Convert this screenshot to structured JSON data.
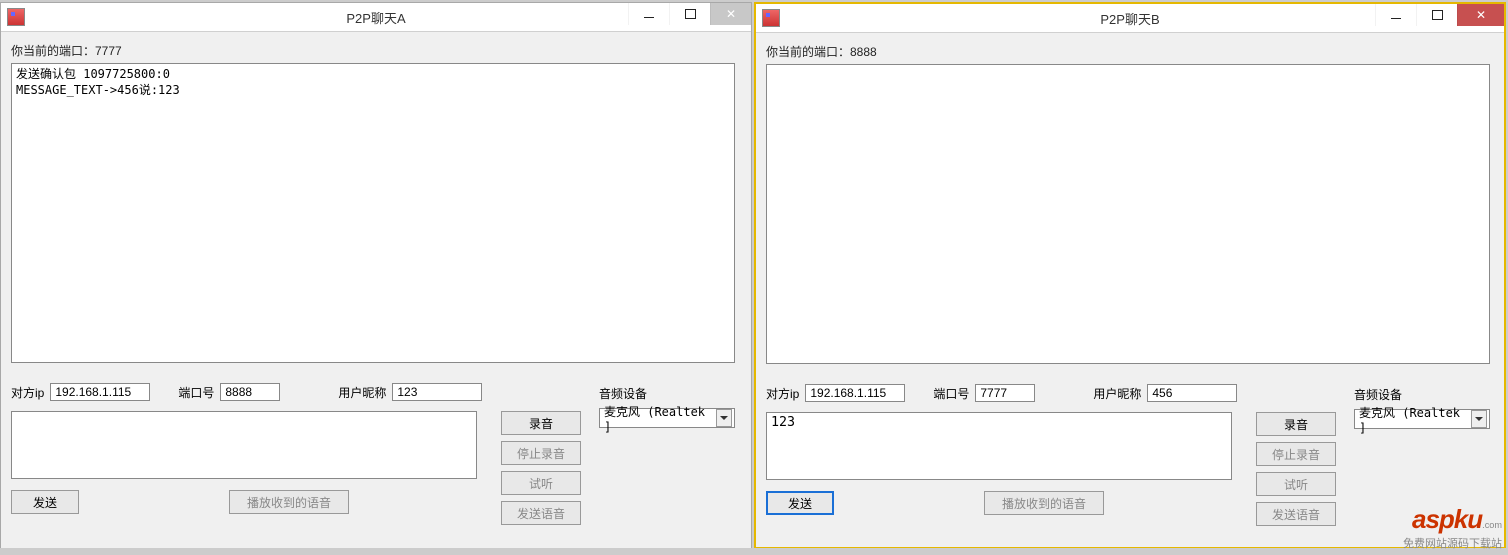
{
  "windowA": {
    "title": "P2P聊天A",
    "port_label": "你当前的端口：7777",
    "chat_log": "发送确认包 1097725800:0\nMESSAGE_TEXT->456说:123",
    "peer_ip_label": "对方ip",
    "peer_ip": "192.168.1.115",
    "port_num_label": "端口号",
    "port_num": "8888",
    "nickname_label": "用户昵称",
    "nickname": "123",
    "message_input": "",
    "send_btn": "发送",
    "play_btn": "播放收到的语音",
    "record_btn": "录音",
    "stop_record_btn": "停止录音",
    "preview_btn": "试听",
    "send_voice_btn": "发送语音",
    "audio_device_label": "音频设备",
    "audio_device": "麦克风 (Realtek ]"
  },
  "windowB": {
    "title": "P2P聊天B",
    "port_label": "你当前的端口：8888",
    "chat_log": "",
    "peer_ip_label": "对方ip",
    "peer_ip": "192.168.1.115",
    "port_num_label": "端口号",
    "port_num": "7777",
    "nickname_label": "用户昵称",
    "nickname": "456",
    "message_input": "123",
    "send_btn": "发送",
    "play_btn": "播放收到的语音",
    "record_btn": "录音",
    "stop_record_btn": "停止录音",
    "preview_btn": "试听",
    "send_voice_btn": "发送语音",
    "audio_device_label": "音频设备",
    "audio_device": "麦克风 (Realtek ]"
  },
  "watermark": {
    "brand": "aspku",
    "suffix": ".com",
    "tag": "免费网站源码下载站"
  }
}
